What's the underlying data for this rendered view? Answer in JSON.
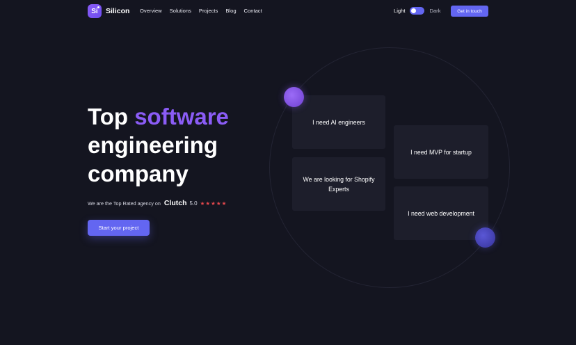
{
  "brand": {
    "logo_text": "Si",
    "name": "Silicon"
  },
  "nav": {
    "links": [
      "Overview",
      "Solutions",
      "Projects",
      "Blog",
      "Contact"
    ]
  },
  "theme": {
    "light_label": "Light",
    "dark_label": "Dark"
  },
  "header": {
    "cta_label": "Get in touch"
  },
  "hero": {
    "title_part1": "Top ",
    "title_accent": "software",
    "title_line2": "engineering",
    "title_line3": "company",
    "rated_text": "We are the Top Rated agency on",
    "clutch_logo": "Clutch",
    "rating": "5.0",
    "stars": [
      "★",
      "★",
      "★",
      "★",
      "★"
    ],
    "cta_label": "Start your project"
  },
  "cards": {
    "c1": "I need AI engineers",
    "c2": "We are looking for Shopify Experts",
    "c3": "I need MVP for startup",
    "c4": "I need web development"
  },
  "colors": {
    "background": "#141520",
    "accent": "#6366f1",
    "accent_text": "#8b5cf6",
    "card": "#1d1e2b",
    "star": "#e5484d"
  }
}
